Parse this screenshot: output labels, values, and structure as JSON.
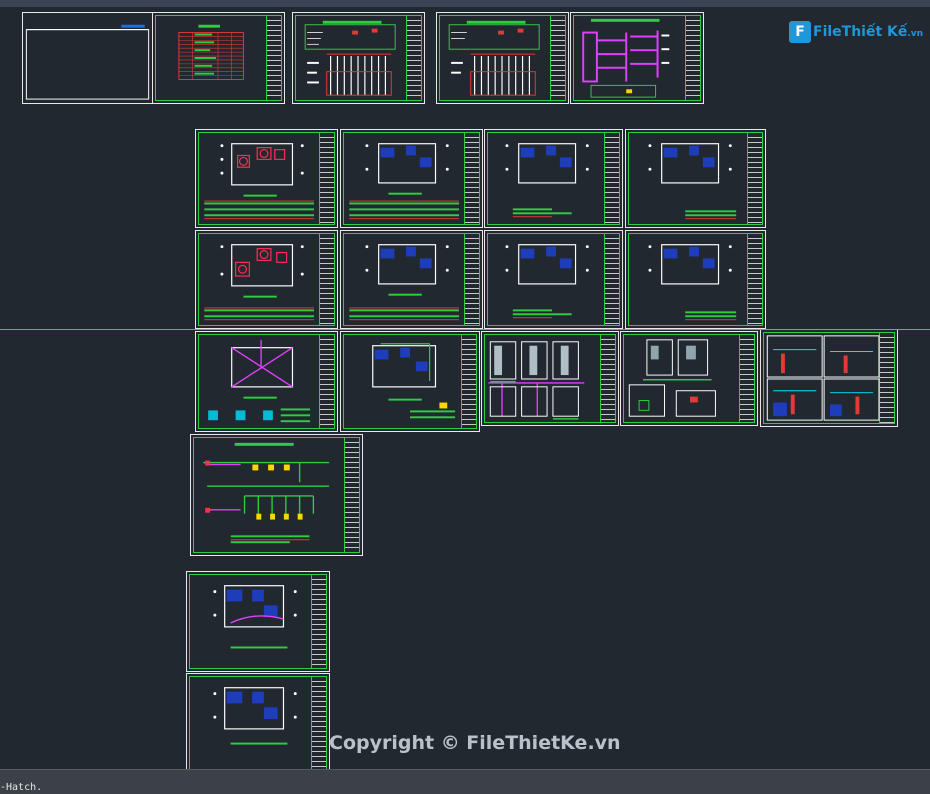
{
  "app": {
    "command_line_text": "-Hatch."
  },
  "watermark": {
    "text": "Copyright © FileThietKe.vn"
  },
  "logo": {
    "mark": "F",
    "text": "FileThiết Kế",
    "tld": ".vn"
  },
  "colors": {
    "background": "#212830",
    "sheet_border": "#e8e8e8",
    "sheet_inner": "#2ecc40",
    "crosshair": "#3fb3c9",
    "logo_blue": "#1f97d8"
  },
  "sheets": [
    {
      "id": "cover",
      "kind": "cover"
    },
    {
      "id": "legend-table",
      "kind": "table"
    },
    {
      "id": "elevation-1",
      "kind": "elevation"
    },
    {
      "id": "elevation-2",
      "kind": "elevation"
    },
    {
      "id": "schematic-magenta",
      "kind": "schematic"
    },
    {
      "id": "floor-plan-1",
      "kind": "plan"
    },
    {
      "id": "floor-plan-2",
      "kind": "plan"
    },
    {
      "id": "floor-plan-3",
      "kind": "plan"
    },
    {
      "id": "floor-plan-4",
      "kind": "plan"
    },
    {
      "id": "floor-plan-5",
      "kind": "plan"
    },
    {
      "id": "floor-plan-6",
      "kind": "plan"
    },
    {
      "id": "floor-plan-7",
      "kind": "plan"
    },
    {
      "id": "floor-plan-8",
      "kind": "plan"
    },
    {
      "id": "roof-plan",
      "kind": "plan"
    },
    {
      "id": "floor-plan-9",
      "kind": "plan"
    },
    {
      "id": "detail-elevations-1",
      "kind": "detail"
    },
    {
      "id": "detail-elevations-2",
      "kind": "detail"
    },
    {
      "id": "detail-sections",
      "kind": "detail"
    },
    {
      "id": "riser-diagram",
      "kind": "schematic"
    },
    {
      "id": "floor-plan-10",
      "kind": "plan"
    },
    {
      "id": "floor-plan-11",
      "kind": "plan"
    }
  ]
}
